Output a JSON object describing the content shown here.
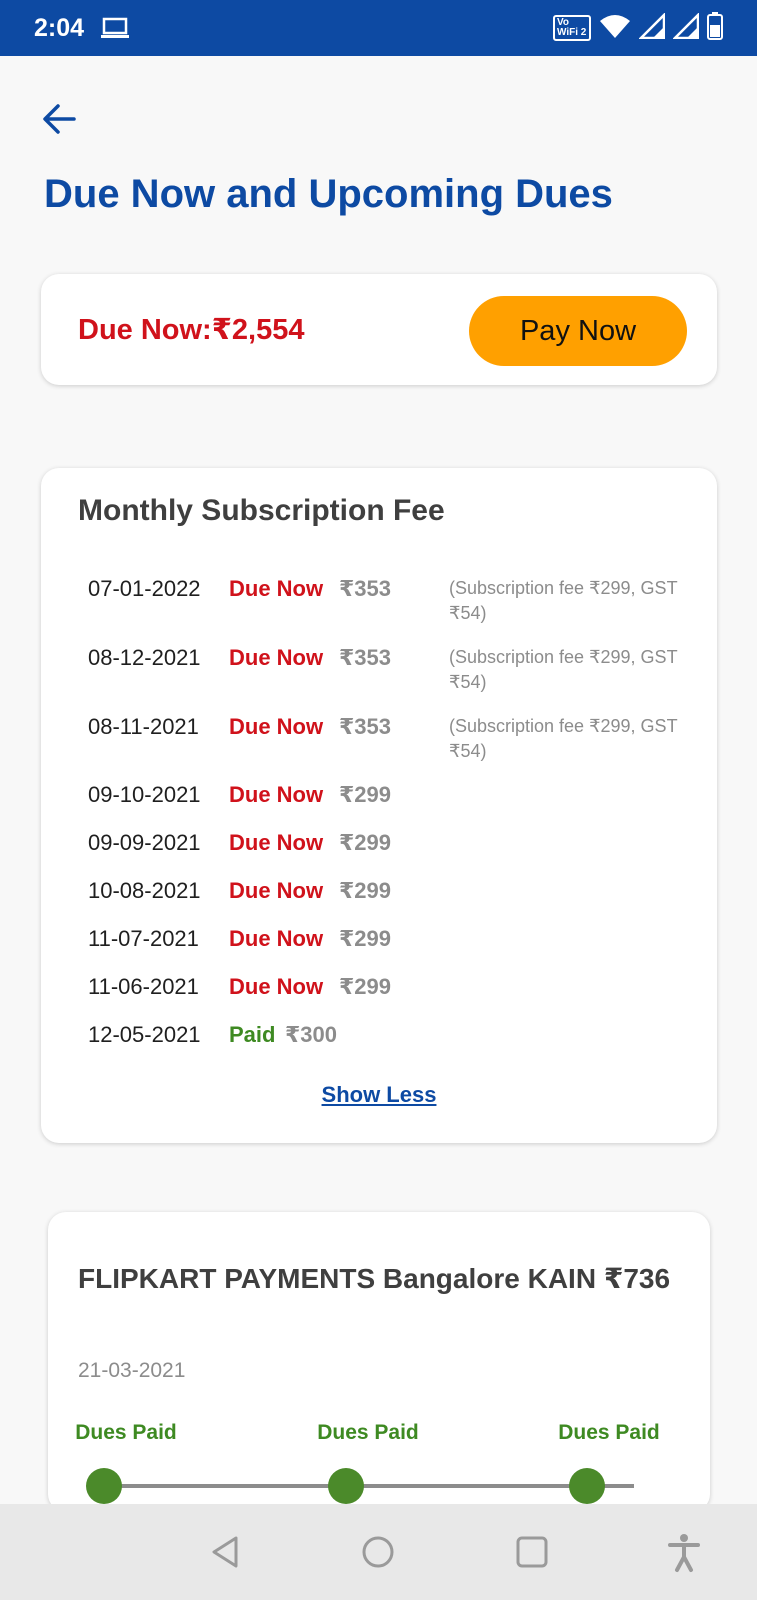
{
  "status_bar": {
    "time": "2:04",
    "icons": [
      "laptop-icon",
      "vowifi-icon",
      "wifi-icon",
      "signal-icon",
      "signal-icon",
      "battery-icon"
    ],
    "vowifi_top": "Vo",
    "vowifi_bottom": "WiFi 2"
  },
  "header": {
    "back_icon": "back-arrow-icon",
    "title": "Due Now and Upcoming Dues"
  },
  "due_card": {
    "due_now_text": "Due Now:₹2,554",
    "pay_button_label": "Pay Now"
  },
  "subscription": {
    "title": "Monthly Subscription Fee",
    "rows": [
      {
        "date": "07-01-2022",
        "status": "Due Now",
        "amount": "₹353",
        "note": "(Subscription fee ₹299, GST ₹54)"
      },
      {
        "date": "08-12-2021",
        "status": "Due Now",
        "amount": "₹353",
        "note": "(Subscription fee ₹299, GST ₹54)"
      },
      {
        "date": "08-11-2021",
        "status": "Due Now",
        "amount": "₹353",
        "note": "(Subscription fee ₹299, GST ₹54)"
      },
      {
        "date": "09-10-2021",
        "status": "Due Now",
        "amount": "₹299"
      },
      {
        "date": "09-09-2021",
        "status": "Due Now",
        "amount": "₹299"
      },
      {
        "date": "10-08-2021",
        "status": "Due Now",
        "amount": "₹299"
      },
      {
        "date": "11-07-2021",
        "status": "Due Now",
        "amount": "₹299"
      },
      {
        "date": "11-06-2021",
        "status": "Due Now",
        "amount": "₹299"
      },
      {
        "date": "12-05-2021",
        "status": "Paid",
        "amount": "₹300"
      }
    ],
    "show_less_label": "Show Less"
  },
  "merchant": {
    "name": "FLIPKART PAYMENTS Bangalore KAIN ₹736",
    "date": "21-03-2021",
    "steps": [
      "Dues Paid",
      "Dues Paid",
      "Dues Paid"
    ]
  },
  "nav_bar": {
    "icons": [
      "back-triangle-icon",
      "home-circle-icon",
      "recents-square-icon",
      "accessibility-icon"
    ]
  },
  "colors": {
    "brand_blue": "#0d4aa3",
    "due_red": "#d0121b",
    "paid_green": "#3e8a22",
    "pay_orange": "#ffa000"
  }
}
